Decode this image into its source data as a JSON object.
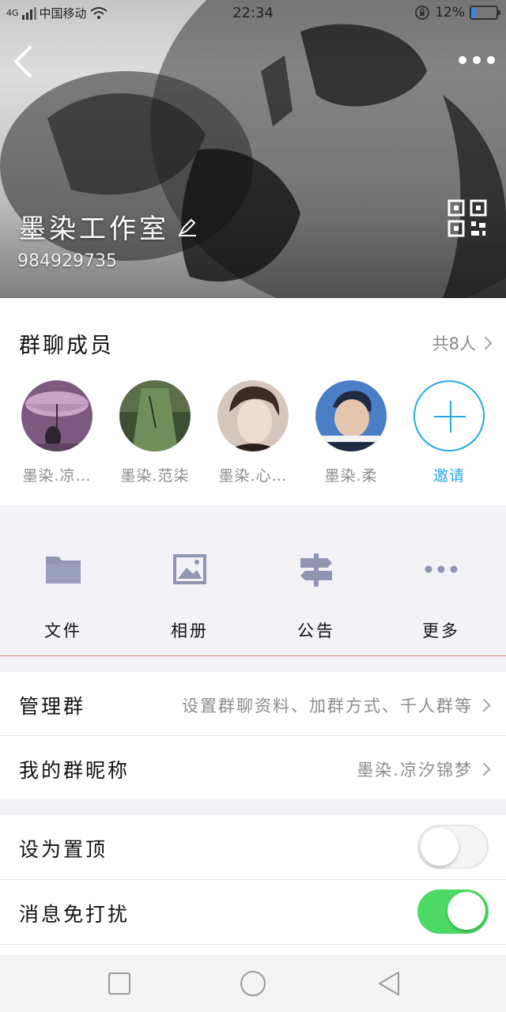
{
  "status_bar": {
    "signal": "4G",
    "carrier": "中国移动",
    "time": "22:34",
    "battery": "12%",
    "battery_level": 0.12,
    "battery_color": "#2b8cff"
  },
  "header": {
    "back_icon": "chevron-left-icon",
    "more_icon": "more-dots-icon",
    "group_name": "墨染工作室",
    "edit_icon": "edit-pencil-icon",
    "group_id": "984929735",
    "qr_icon": "qr-code-icon"
  },
  "members": {
    "title": "群聊成员",
    "count": "共8人",
    "list": [
      {
        "name": "墨染.凉…",
        "avatar_colors": [
          "#c9a4c8",
          "#7c5a80"
        ]
      },
      {
        "name": "墨染.范柒",
        "avatar_colors": [
          "#6f8f5a",
          "#3c4f32"
        ]
      },
      {
        "name": "墨染.心…",
        "avatar_colors": [
          "#d6c7be",
          "#3b2a25"
        ]
      },
      {
        "name": "墨染.柔",
        "avatar_colors": [
          "#4a7fc6",
          "#1f2b44"
        ]
      }
    ],
    "invite_label": "邀请",
    "accent": "#27a9e1"
  },
  "actions": [
    {
      "label": "文件",
      "icon": "folder-icon"
    },
    {
      "label": "相册",
      "icon": "image-icon"
    },
    {
      "label": "公告",
      "icon": "signpost-icon"
    },
    {
      "label": "更多",
      "icon": "more-horizontal-icon"
    }
  ],
  "settings": {
    "manage": {
      "label": "管理群",
      "value": "设置群聊资料、加群方式、千人群等"
    },
    "nickname": {
      "label": "我的群昵称",
      "value": "墨染.凉汐锦梦"
    },
    "pin": {
      "label": "设为置顶",
      "on": false
    },
    "mute": {
      "label": "消息免打扰",
      "on": true
    },
    "toggle_on_color": "#4cd964"
  },
  "navbar": {
    "recent_icon": "square-icon",
    "home_icon": "circle-icon",
    "back_icon": "triangle-back-icon"
  }
}
